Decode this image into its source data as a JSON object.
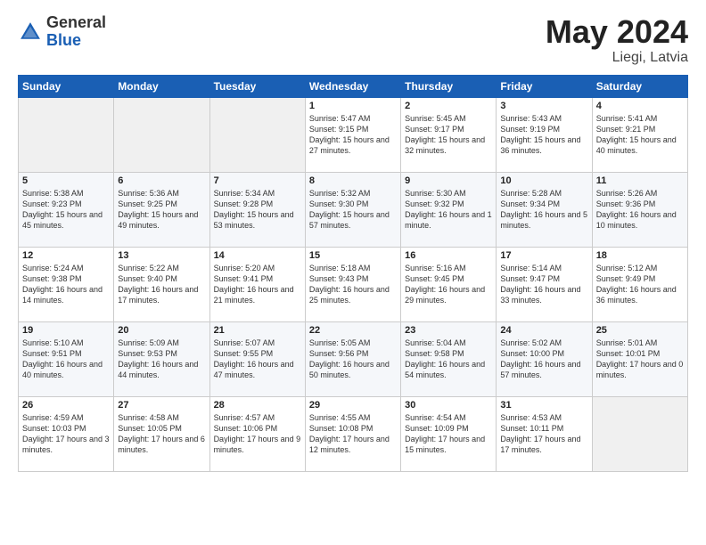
{
  "logo": {
    "text_general": "General",
    "text_blue": "Blue"
  },
  "header": {
    "month_title": "May 2024",
    "location": "Liegi, Latvia"
  },
  "weekdays": [
    "Sunday",
    "Monday",
    "Tuesday",
    "Wednesday",
    "Thursday",
    "Friday",
    "Saturday"
  ],
  "rows": [
    [
      {
        "day": "",
        "empty": true
      },
      {
        "day": "",
        "empty": true
      },
      {
        "day": "",
        "empty": true
      },
      {
        "day": "1",
        "sunrise": "5:47 AM",
        "sunset": "9:15 PM",
        "daylight": "15 hours and 27 minutes."
      },
      {
        "day": "2",
        "sunrise": "5:45 AM",
        "sunset": "9:17 PM",
        "daylight": "15 hours and 32 minutes."
      },
      {
        "day": "3",
        "sunrise": "5:43 AM",
        "sunset": "9:19 PM",
        "daylight": "15 hours and 36 minutes."
      },
      {
        "day": "4",
        "sunrise": "5:41 AM",
        "sunset": "9:21 PM",
        "daylight": "15 hours and 40 minutes."
      }
    ],
    [
      {
        "day": "5",
        "sunrise": "5:38 AM",
        "sunset": "9:23 PM",
        "daylight": "15 hours and 45 minutes."
      },
      {
        "day": "6",
        "sunrise": "5:36 AM",
        "sunset": "9:25 PM",
        "daylight": "15 hours and 49 minutes."
      },
      {
        "day": "7",
        "sunrise": "5:34 AM",
        "sunset": "9:28 PM",
        "daylight": "15 hours and 53 minutes."
      },
      {
        "day": "8",
        "sunrise": "5:32 AM",
        "sunset": "9:30 PM",
        "daylight": "15 hours and 57 minutes."
      },
      {
        "day": "9",
        "sunrise": "5:30 AM",
        "sunset": "9:32 PM",
        "daylight": "16 hours and 1 minute."
      },
      {
        "day": "10",
        "sunrise": "5:28 AM",
        "sunset": "9:34 PM",
        "daylight": "16 hours and 5 minutes."
      },
      {
        "day": "11",
        "sunrise": "5:26 AM",
        "sunset": "9:36 PM",
        "daylight": "16 hours and 10 minutes."
      }
    ],
    [
      {
        "day": "12",
        "sunrise": "5:24 AM",
        "sunset": "9:38 PM",
        "daylight": "16 hours and 14 minutes."
      },
      {
        "day": "13",
        "sunrise": "5:22 AM",
        "sunset": "9:40 PM",
        "daylight": "16 hours and 17 minutes."
      },
      {
        "day": "14",
        "sunrise": "5:20 AM",
        "sunset": "9:41 PM",
        "daylight": "16 hours and 21 minutes."
      },
      {
        "day": "15",
        "sunrise": "5:18 AM",
        "sunset": "9:43 PM",
        "daylight": "16 hours and 25 minutes."
      },
      {
        "day": "16",
        "sunrise": "5:16 AM",
        "sunset": "9:45 PM",
        "daylight": "16 hours and 29 minutes."
      },
      {
        "day": "17",
        "sunrise": "5:14 AM",
        "sunset": "9:47 PM",
        "daylight": "16 hours and 33 minutes."
      },
      {
        "day": "18",
        "sunrise": "5:12 AM",
        "sunset": "9:49 PM",
        "daylight": "16 hours and 36 minutes."
      }
    ],
    [
      {
        "day": "19",
        "sunrise": "5:10 AM",
        "sunset": "9:51 PM",
        "daylight": "16 hours and 40 minutes."
      },
      {
        "day": "20",
        "sunrise": "5:09 AM",
        "sunset": "9:53 PM",
        "daylight": "16 hours and 44 minutes."
      },
      {
        "day": "21",
        "sunrise": "5:07 AM",
        "sunset": "9:55 PM",
        "daylight": "16 hours and 47 minutes."
      },
      {
        "day": "22",
        "sunrise": "5:05 AM",
        "sunset": "9:56 PM",
        "daylight": "16 hours and 50 minutes."
      },
      {
        "day": "23",
        "sunrise": "5:04 AM",
        "sunset": "9:58 PM",
        "daylight": "16 hours and 54 minutes."
      },
      {
        "day": "24",
        "sunrise": "5:02 AM",
        "sunset": "10:00 PM",
        "daylight": "16 hours and 57 minutes."
      },
      {
        "day": "25",
        "sunrise": "5:01 AM",
        "sunset": "10:01 PM",
        "daylight": "17 hours and 0 minutes."
      }
    ],
    [
      {
        "day": "26",
        "sunrise": "4:59 AM",
        "sunset": "10:03 PM",
        "daylight": "17 hours and 3 minutes."
      },
      {
        "day": "27",
        "sunrise": "4:58 AM",
        "sunset": "10:05 PM",
        "daylight": "17 hours and 6 minutes."
      },
      {
        "day": "28",
        "sunrise": "4:57 AM",
        "sunset": "10:06 PM",
        "daylight": "17 hours and 9 minutes."
      },
      {
        "day": "29",
        "sunrise": "4:55 AM",
        "sunset": "10:08 PM",
        "daylight": "17 hours and 12 minutes."
      },
      {
        "day": "30",
        "sunrise": "4:54 AM",
        "sunset": "10:09 PM",
        "daylight": "17 hours and 15 minutes."
      },
      {
        "day": "31",
        "sunrise": "4:53 AM",
        "sunset": "10:11 PM",
        "daylight": "17 hours and 17 minutes."
      },
      {
        "day": "",
        "empty": true
      }
    ]
  ]
}
